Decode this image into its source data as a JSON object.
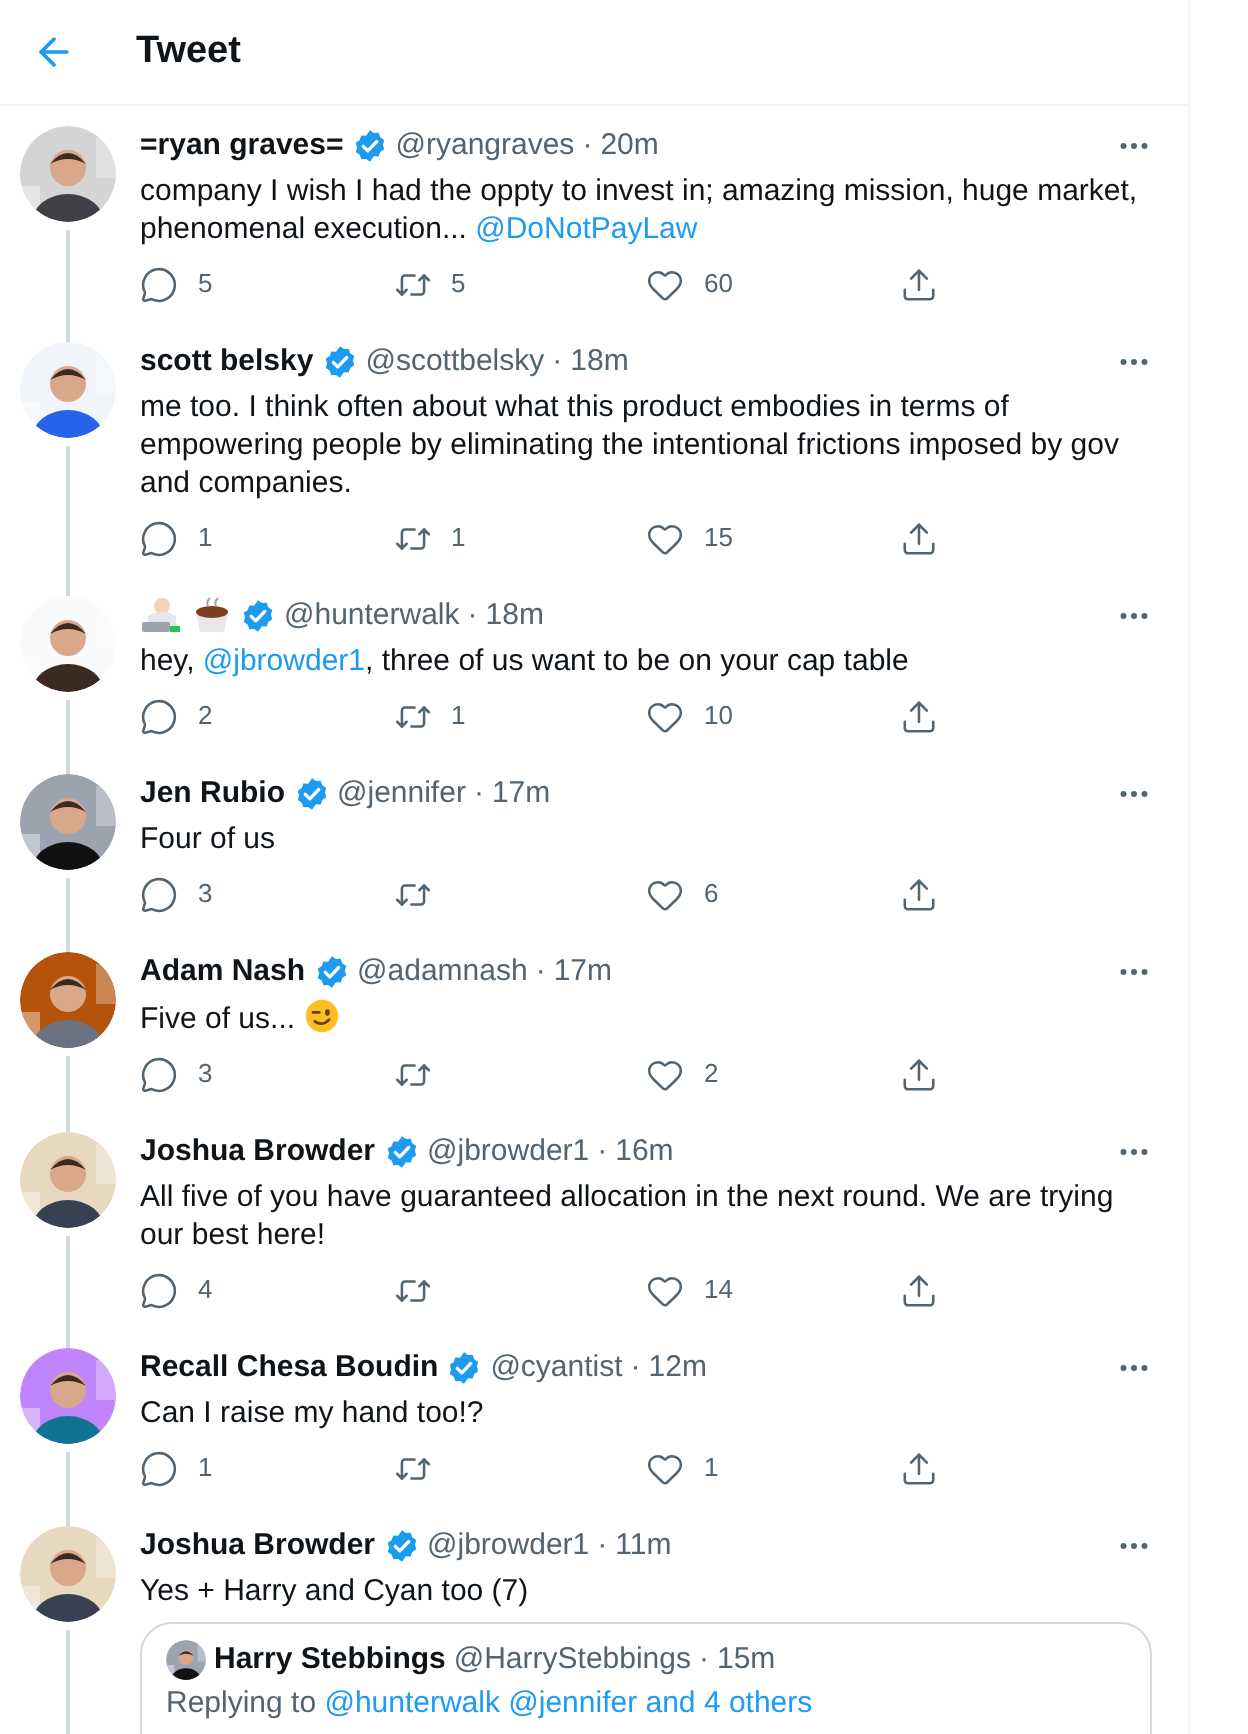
{
  "header": {
    "title": "Tweet"
  },
  "tweets": [
    {
      "name": "=ryan graves=",
      "handle": "@ryangraves",
      "separator": "·",
      "time": "20m",
      "text": [
        {
          "kind": "text",
          "text": "company I wish I had the oppty to invest in; amazing mission, huge market, phenomenal execution... "
        },
        {
          "kind": "mention",
          "text": "@DoNotPayLaw"
        }
      ],
      "actions": [
        {
          "kind": "reply",
          "count": "5"
        },
        {
          "kind": "retweet",
          "count": "5"
        },
        {
          "kind": "like",
          "count": "60"
        },
        {
          "kind": "share"
        }
      ]
    },
    {
      "name": "scott belsky",
      "handle": "@scottbelsky",
      "separator": "·",
      "time": "18m",
      "text": [
        {
          "kind": "text",
          "text": "me too. I think often about what this product embodies in terms of empowering people by eliminating the intentional frictions imposed by gov and companies."
        }
      ],
      "actions": [
        {
          "kind": "reply",
          "count": "1"
        },
        {
          "kind": "retweet",
          "count": "1"
        },
        {
          "kind": "like",
          "count": "15"
        },
        {
          "kind": "share"
        }
      ]
    },
    {
      "name_emoji": [
        {
          "kind": "technologist"
        },
        {
          "kind": "coffee"
        }
      ],
      "handle": "@hunterwalk",
      "separator": "·",
      "time": "18m",
      "text": [
        {
          "kind": "text",
          "text": "hey, "
        },
        {
          "kind": "mention",
          "text": "@jbrowder1"
        },
        {
          "kind": "text",
          "text": ", three of us want to be on your cap table"
        }
      ],
      "actions": [
        {
          "kind": "reply",
          "count": "2"
        },
        {
          "kind": "retweet",
          "count": "1"
        },
        {
          "kind": "like",
          "count": "10"
        },
        {
          "kind": "share"
        }
      ]
    },
    {
      "name": "Jen Rubio",
      "handle": "@jennifer",
      "separator": "·",
      "time": "17m",
      "text": [
        {
          "kind": "text",
          "text": "Four of us"
        }
      ],
      "actions": [
        {
          "kind": "reply",
          "count": "3"
        },
        {
          "kind": "retweet"
        },
        {
          "kind": "like",
          "count": "6"
        },
        {
          "kind": "share"
        }
      ]
    },
    {
      "name": "Adam Nash",
      "handle": "@adamnash",
      "separator": "·",
      "time": "17m",
      "text": [
        {
          "kind": "text",
          "text": "Five of us... "
        },
        {
          "kind": "wink"
        }
      ],
      "actions": [
        {
          "kind": "reply",
          "count": "3"
        },
        {
          "kind": "retweet"
        },
        {
          "kind": "like",
          "count": "2"
        },
        {
          "kind": "share"
        }
      ]
    },
    {
      "name": "Joshua Browder",
      "handle": "@jbrowder1",
      "separator": "·",
      "time": "16m",
      "text": [
        {
          "kind": "text",
          "text": "All five of you have guaranteed allocation in the next round. We are trying our best here!"
        }
      ],
      "actions": [
        {
          "kind": "reply",
          "count": "4"
        },
        {
          "kind": "retweet"
        },
        {
          "kind": "like",
          "count": "14"
        },
        {
          "kind": "share"
        }
      ]
    },
    {
      "name": "Recall Chesa Boudin",
      "handle": "@cyantist",
      "separator": "·",
      "time": "12m",
      "text": [
        {
          "kind": "text",
          "text": "Can I raise my hand too!?"
        }
      ],
      "actions": [
        {
          "kind": "reply",
          "count": "1"
        },
        {
          "kind": "retweet"
        },
        {
          "kind": "like",
          "count": "1"
        },
        {
          "kind": "share"
        }
      ]
    },
    {
      "name": "Joshua Browder",
      "handle": "@jbrowder1",
      "separator": "·",
      "time": "11m",
      "text": [
        {
          "kind": "text",
          "text": "Yes + Harry and Cyan too (7)"
        }
      ],
      "quote": {
        "name": "Harry Stebbings",
        "handle": "@HarryStebbings",
        "separator": "·",
        "time": "15m",
        "replying_label": "Replying to",
        "replying_targets": "@hunterwalk @jennifer and 4 others"
      }
    }
  ]
}
